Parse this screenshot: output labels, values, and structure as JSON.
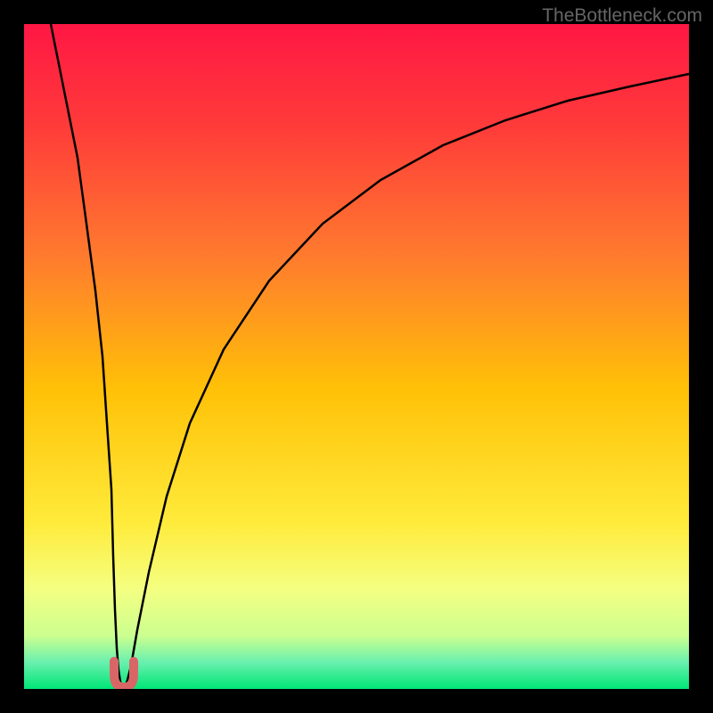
{
  "watermark": "TheBottleneck.com",
  "chart_data": {
    "type": "line",
    "title": "",
    "xlabel": "",
    "ylabel": "",
    "xlim": [
      0,
      100
    ],
    "ylim": [
      0,
      100
    ],
    "background": {
      "type": "vertical-gradient",
      "stops": [
        {
          "pos": 0,
          "color": "#ff1744"
        },
        {
          "pos": 15,
          "color": "#ff3a3a"
        },
        {
          "pos": 35,
          "color": "#ff7b2e"
        },
        {
          "pos": 55,
          "color": "#ffc107"
        },
        {
          "pos": 75,
          "color": "#ffeb3b"
        },
        {
          "pos": 85,
          "color": "#f4ff81"
        },
        {
          "pos": 92,
          "color": "#ccff90"
        },
        {
          "pos": 96,
          "color": "#69f0ae"
        },
        {
          "pos": 100,
          "color": "#00e676"
        }
      ]
    },
    "series": [
      {
        "name": "bottleneck-curve",
        "color": "#000000",
        "width": 2,
        "description": "V-shaped curve with minimum around x=14; left branch steep descending from top-left, right branch asymptotically rising toward top-right",
        "points": [
          {
            "x": 4,
            "y": 100
          },
          {
            "x": 6,
            "y": 80
          },
          {
            "x": 8,
            "y": 60
          },
          {
            "x": 10,
            "y": 40
          },
          {
            "x": 12,
            "y": 20
          },
          {
            "x": 13,
            "y": 8
          },
          {
            "x": 13.5,
            "y": 3
          },
          {
            "x": 14,
            "y": 1
          },
          {
            "x": 14.5,
            "y": 1
          },
          {
            "x": 15,
            "y": 2
          },
          {
            "x": 15.5,
            "y": 4
          },
          {
            "x": 17,
            "y": 12
          },
          {
            "x": 20,
            "y": 28
          },
          {
            "x": 25,
            "y": 45
          },
          {
            "x": 30,
            "y": 57
          },
          {
            "x": 40,
            "y": 71
          },
          {
            "x": 50,
            "y": 79
          },
          {
            "x": 60,
            "y": 84
          },
          {
            "x": 70,
            "y": 88
          },
          {
            "x": 80,
            "y": 90
          },
          {
            "x": 90,
            "y": 92
          },
          {
            "x": 100,
            "y": 93
          }
        ]
      }
    ],
    "markers": [
      {
        "name": "minimum-marker",
        "shape": "u-shape",
        "color": "#e06666",
        "x": 14,
        "y": 2,
        "width": 3
      }
    ]
  }
}
